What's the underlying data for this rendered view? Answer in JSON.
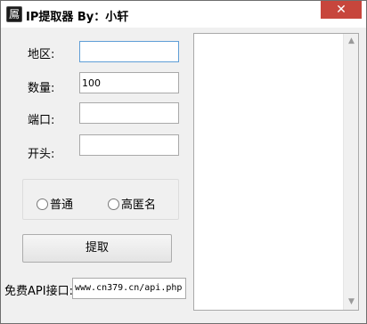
{
  "window": {
    "title": "IP提取器  By：小轩",
    "icon": "app-icon-glyph",
    "icon_glyph": "䲩",
    "close_glyph": "✕"
  },
  "form": {
    "region_label": "地区:",
    "region_value": "",
    "count_label": "数量:",
    "count_value": "100",
    "port_label": "端口:",
    "port_value": "",
    "prefix_label": "开头:",
    "prefix_value": ""
  },
  "mode": {
    "options": [
      "普通",
      "高匿名"
    ],
    "selected": null
  },
  "actions": {
    "extract_label": "提取"
  },
  "api": {
    "label": "免费API接口:",
    "value": "www.cn379.cn/api.php"
  },
  "output": {
    "text": "",
    "scroll_up_glyph": "▲",
    "scroll_down_glyph": "▼"
  }
}
